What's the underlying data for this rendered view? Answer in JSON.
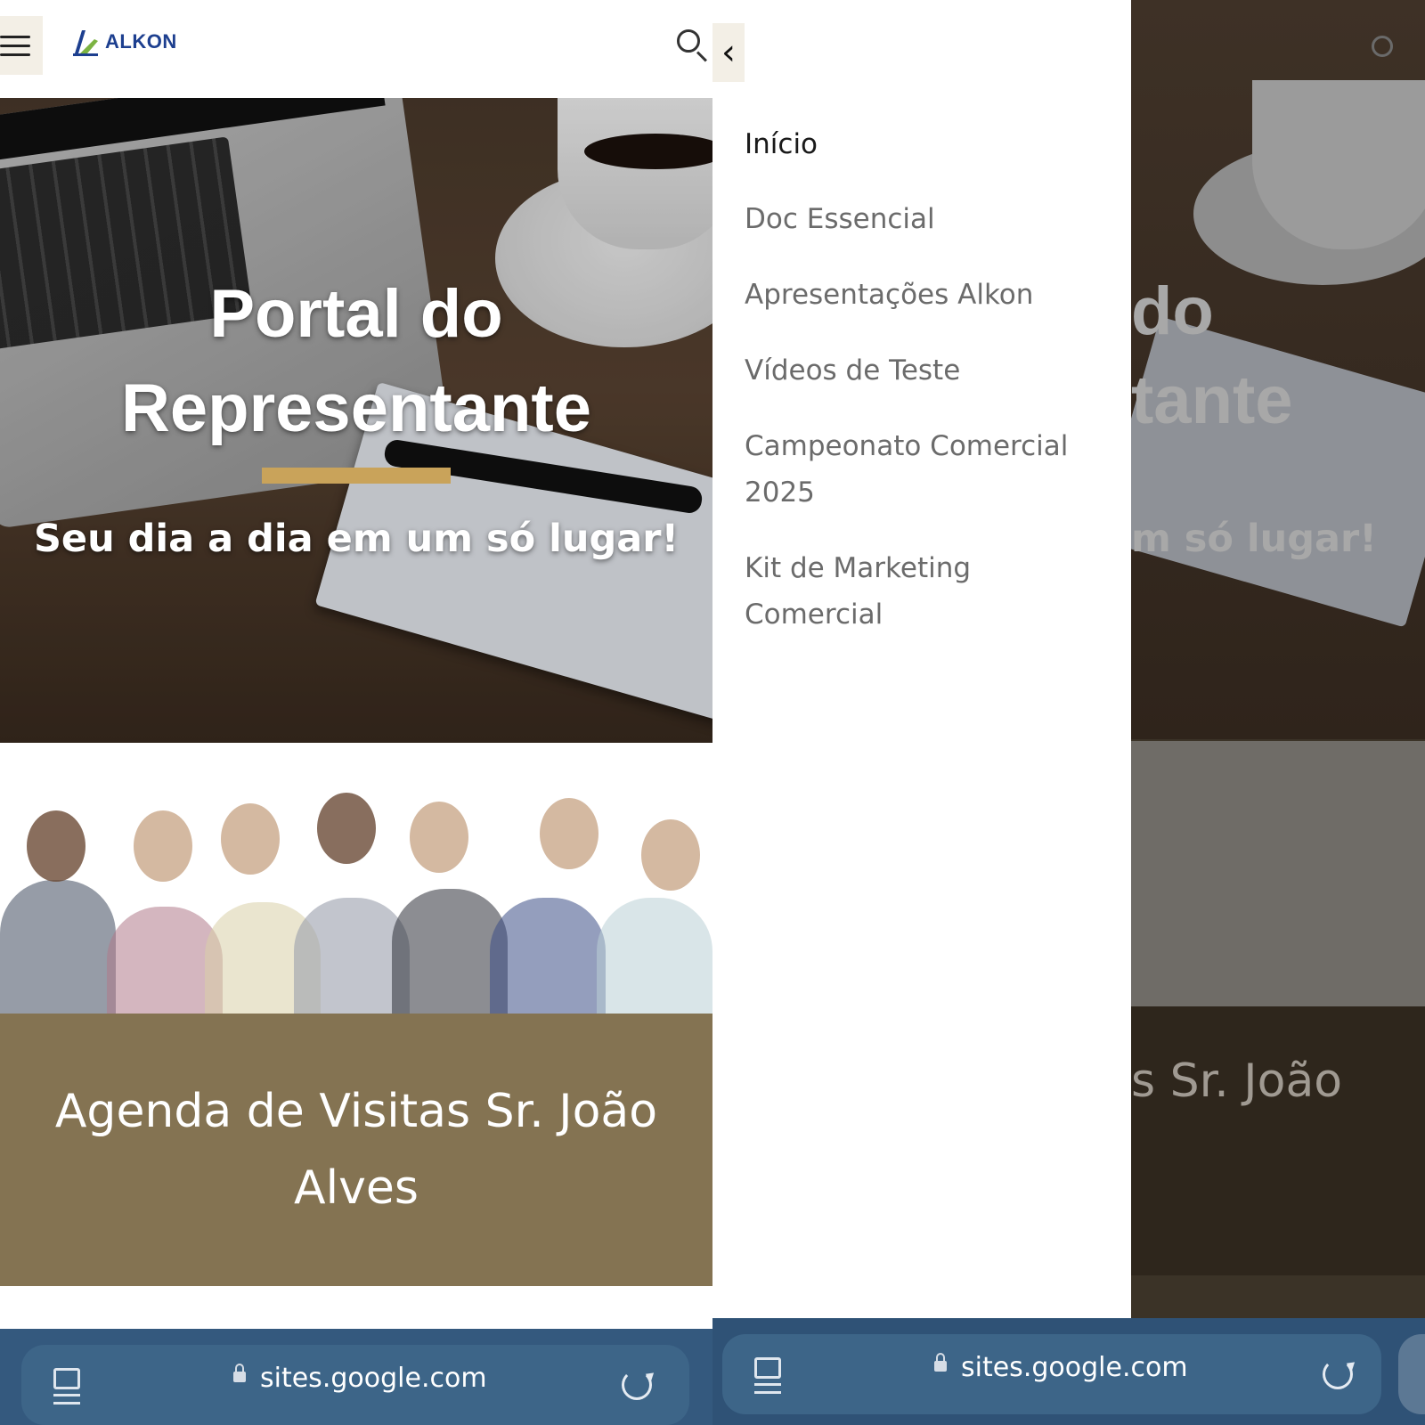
{
  "app": {
    "logo_text": "ALKON"
  },
  "hero": {
    "title": "Portal do Representante",
    "subtitle": "Seu dia a dia em um só lugar!"
  },
  "agenda": {
    "title": "Agenda de Visitas Sr. João Alves"
  },
  "drawer": {
    "back_glyph": "‹",
    "items": [
      {
        "label": "Início",
        "active": true
      },
      {
        "label": "Doc Essencial",
        "active": false
      },
      {
        "label": "Apresentações Alkon",
        "active": false
      },
      {
        "label": "Vídeos de Teste",
        "active": false
      },
      {
        "label": "Campeonato Comercial 2025",
        "active": false
      },
      {
        "label": "Kit de Marketing Comercial",
        "active": false
      }
    ]
  },
  "background_preview": {
    "title_fragment_1": "do",
    "title_fragment_2": "tante",
    "subtitle_fragment": "m só lugar!",
    "agenda_fragment": "s Sr. João"
  },
  "browser": {
    "url": "sites.google.com"
  },
  "colors": {
    "accent_gold": "#c9a35a",
    "agenda_bg": "#847352",
    "brand_blue": "#1d3f8f",
    "browser_bar": "#34597e"
  },
  "icons": {
    "menu": "hamburger-icon",
    "search": "search-icon",
    "back": "chevron-left-icon",
    "tabs": "tabs-icon",
    "lock": "lock-icon",
    "reload": "reload-icon"
  }
}
